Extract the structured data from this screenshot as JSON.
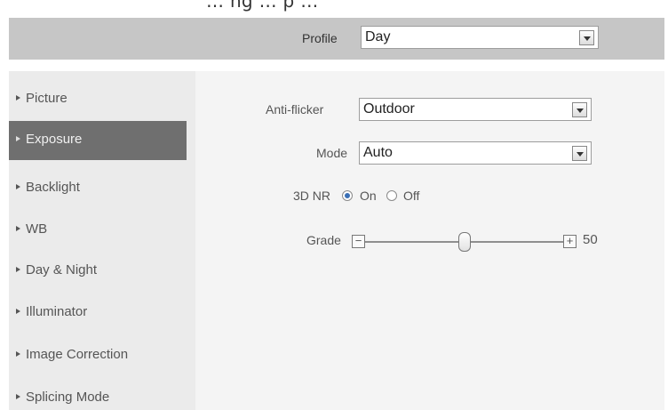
{
  "page_heading_partial": "… ng … p …",
  "profile": {
    "label": "Profile",
    "value": "Day"
  },
  "sidebar": {
    "items": [
      {
        "label": "Picture",
        "active": false
      },
      {
        "label": "Exposure",
        "active": true
      },
      {
        "label": "Backlight",
        "active": false
      },
      {
        "label": "WB",
        "active": false
      },
      {
        "label": "Day & Night",
        "active": false
      },
      {
        "label": "Illuminator",
        "active": false
      },
      {
        "label": "Image Correction",
        "active": false
      },
      {
        "label": "Splicing Mode",
        "active": false
      }
    ]
  },
  "exposure": {
    "anti_flicker": {
      "label": "Anti-flicker",
      "value": "Outdoor"
    },
    "mode": {
      "label": "Mode",
      "value": "Auto"
    },
    "nr3d": {
      "label": "3D NR",
      "options": [
        {
          "label": "On",
          "checked": true
        },
        {
          "label": "Off",
          "checked": false
        }
      ]
    },
    "grade": {
      "label": "Grade",
      "value": "50",
      "min_glyph": "−",
      "max_glyph": "+",
      "level": 0.5
    }
  },
  "icons": {
    "dropdown": "dropdown-arrow-icon",
    "nav": "triangle-right-icon"
  }
}
